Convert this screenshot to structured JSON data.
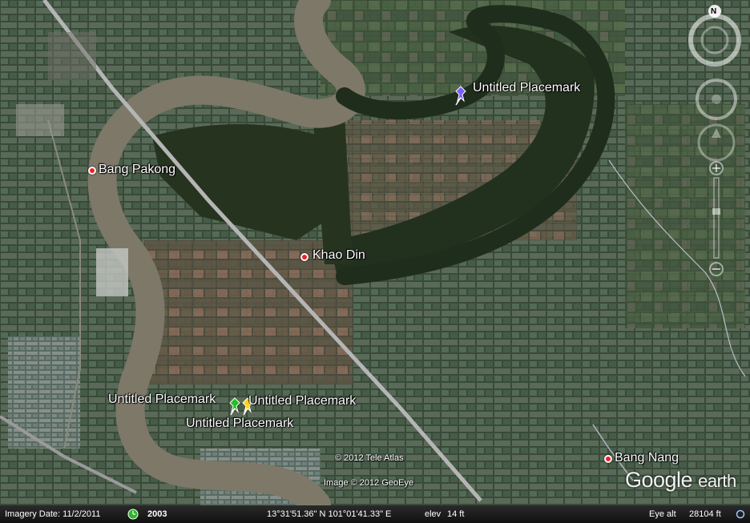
{
  "places": [
    {
      "name": "Bang Pakong"
    },
    {
      "name": "Khao Din"
    },
    {
      "name": "Bang Nang"
    }
  ],
  "placemarks": [
    {
      "name": "Untitled Placemark",
      "color": "#7b5cff"
    },
    {
      "name": "Untitled Placemark",
      "color": "#22c022"
    },
    {
      "name": "Untitled Placemark",
      "color": "#ffd21e"
    },
    {
      "name": "Untitled Placemark",
      "color": "#ffd21e"
    }
  ],
  "credits": {
    "tele_atlas": "© 2012 Tele Atlas",
    "geoeye": "Image © 2012 GeoEye"
  },
  "logo": {
    "google": "Google",
    "earth": "earth"
  },
  "status": {
    "imagery_date": "Imagery Date: 11/2/2011",
    "year": "2003",
    "coordinates": "13°31'51.36\" N 101°01'41.33\" E",
    "elev_label": "elev",
    "elev_value": "14 ft",
    "eye_alt_label": "Eye alt",
    "eye_alt_value": "28104 ft"
  },
  "compass": {
    "north": "N"
  },
  "colors": {
    "river": "#7e7868",
    "road": "#b5b5b5",
    "land": "#33452f"
  }
}
